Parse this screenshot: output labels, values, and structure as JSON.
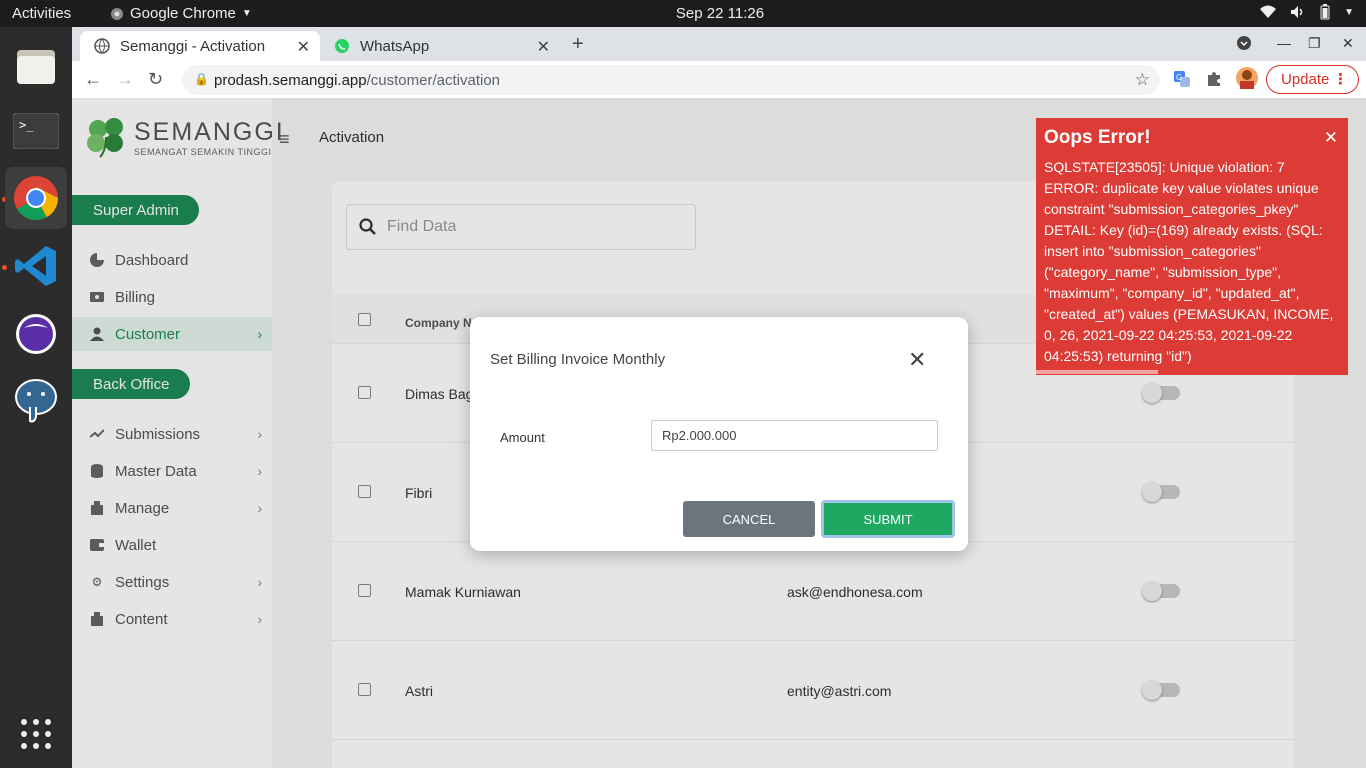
{
  "system": {
    "activities": "Activities",
    "app_name": "Google Chrome",
    "clock": "Sep 22  11:26"
  },
  "browser": {
    "tabs": [
      {
        "title": "Semanggi - Activation",
        "active": true
      },
      {
        "title": "WhatsApp",
        "active": false
      }
    ],
    "url_host": "prodash.semanggi.app",
    "url_path": "/customer/activation",
    "update_label": "Update"
  },
  "app": {
    "logo_name": "SEMANGGI",
    "logo_tagline": "SEMANGAT SEMAKIN TINGGI",
    "breadcrumb": "Activation",
    "sections": {
      "super_admin": "Super Admin",
      "back_office": "Back Office"
    },
    "nav": {
      "dashboard": "Dashboard",
      "billing": "Billing",
      "customer": "Customer",
      "submissions": "Submissions",
      "master_data": "Master Data",
      "manage": "Manage",
      "wallet": "Wallet",
      "settings": "Settings",
      "content": "Content"
    },
    "search_placeholder": "Find Data",
    "table": {
      "col_company": "Company N",
      "rows": [
        {
          "name": "Dimas Bag",
          "email": ""
        },
        {
          "name": "Fibri",
          "email": ""
        },
        {
          "name": "Mamak Kurniawan",
          "email": "ask@endhonesa.com"
        },
        {
          "name": "Astri",
          "email": "entity@astri.com"
        }
      ]
    }
  },
  "modal": {
    "title": "Set Billing Invoice Monthly",
    "amount_label": "Amount",
    "amount_value": "Rp2.000.000",
    "cancel_label": "CANCEL",
    "submit_label": "SUBMIT"
  },
  "toast": {
    "title": "Oops Error!",
    "message": "SQLSTATE[23505]: Unique violation: 7 ERROR: duplicate key value violates unique constraint \"submission_categories_pkey\" DETAIL: Key (id)=(169) already exists. (SQL: insert into \"submission_categories\" (\"category_name\", \"submission_type\", \"maximum\", \"company_id\", \"updated_at\", \"created_at\") values (PEMASUKAN, INCOME, 0, 26, 2021-09-22 04:25:53, 2021-09-22 04:25:53) returning \"id\")",
    "progress": 0.39
  },
  "colors": {
    "brand_green": "#1e8c56",
    "error_red": "#dd3b35",
    "submit_green": "#1ea862",
    "cancel_gray": "#6c757d"
  }
}
